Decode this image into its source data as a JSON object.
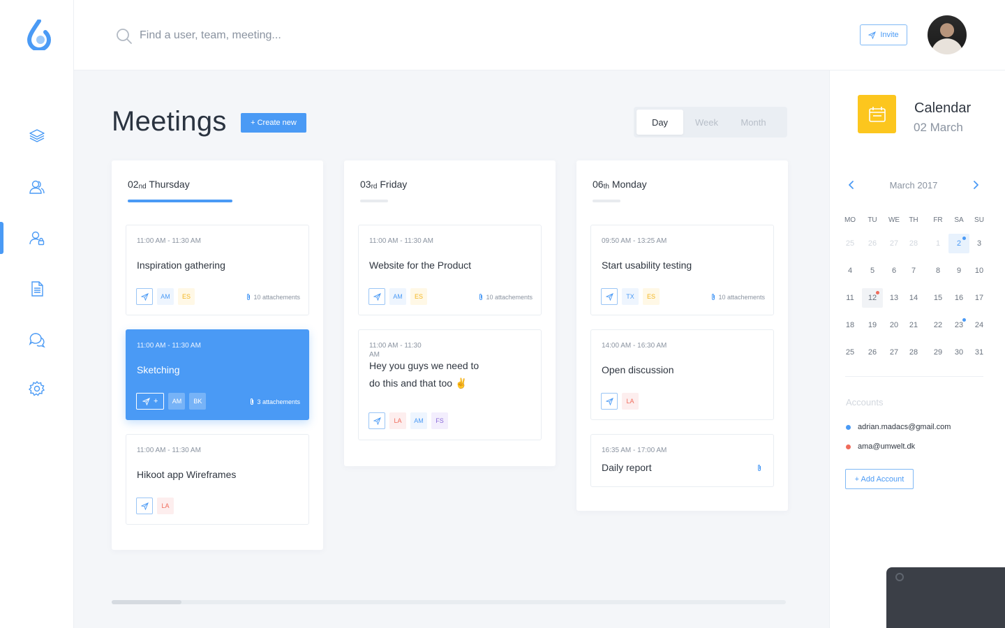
{
  "search": {
    "placeholder": "Find a user, team, meeting..."
  },
  "header": {
    "invite_label": "Invite"
  },
  "nav": {
    "items": [
      {
        "name": "layers-icon"
      },
      {
        "name": "users-icon"
      },
      {
        "name": "user-lock-icon",
        "active": true
      },
      {
        "name": "document-icon"
      },
      {
        "name": "chat-icon"
      },
      {
        "name": "gear-icon"
      }
    ]
  },
  "main": {
    "title": "Meetings",
    "create_label": "+ Create new",
    "views": [
      "Day",
      "Week",
      "Month"
    ],
    "active_view": "Day",
    "days": [
      {
        "num": "02",
        "suffix": "nd",
        "weekday": "Thursday",
        "meetings": [
          {
            "time": "11:00 AM - 11:30 AM",
            "title": "Inspiration gathering",
            "tags": [
              "AM",
              "ES"
            ],
            "attachments": "10 attachements"
          },
          {
            "time": "11:00 AM - 11:30 AM",
            "title": "Sketching",
            "tags": [
              "AM",
              "BK"
            ],
            "attachments": "3 attachements",
            "btn_plus": "+"
          },
          {
            "time": "11:00 AM - 11:30 AM",
            "title": "Hikoot app Wireframes",
            "tags": [
              "LA"
            ]
          }
        ]
      },
      {
        "num": "03",
        "suffix": "rd",
        "weekday": "Friday",
        "meetings": [
          {
            "time": "11:00 AM - 11:30 AM",
            "title": "Website for the Product",
            "tags": [
              "AM",
              "ES"
            ],
            "attachments": "10 attachements"
          },
          {
            "time_line1": "11:00 AM - 11:30",
            "time_line2": "AM",
            "title_line1": "Hey you guys we need to",
            "title_line2": "do this and that too ✌️",
            "tags": [
              "LA",
              "AM",
              "FS"
            ]
          }
        ]
      },
      {
        "num": "06",
        "suffix": "th",
        "weekday": "Monday",
        "meetings": [
          {
            "time": "09:50 AM - 13:25 AM",
            "title": "Start usability testing",
            "tags": [
              "TX",
              "ES"
            ],
            "attachments": "10 attachements"
          },
          {
            "time": "14:00 AM - 16:30 AM",
            "title": "Open discussion",
            "tags": [
              "LA"
            ]
          },
          {
            "time": "16:35 AM - 17:00 AM",
            "title": "Daily report"
          }
        ]
      }
    ]
  },
  "calendar": {
    "title": "Calendar",
    "date": "02 March",
    "month_label": "March 2017",
    "weekdays": [
      "MO",
      "TU",
      "WE",
      "TH",
      "FR",
      "SA",
      "SU"
    ],
    "weeks": [
      [
        "25",
        "26",
        "27",
        "28",
        "1",
        "2",
        "3"
      ],
      [
        "4",
        "5",
        "6",
        "7",
        "8",
        "9",
        "10"
      ],
      [
        "11",
        "12",
        "13",
        "14",
        "15",
        "16",
        "17"
      ],
      [
        "18",
        "19",
        "20",
        "21",
        "22",
        "23",
        "24"
      ],
      [
        "25",
        "26",
        "27",
        "28",
        "29",
        "30",
        "31"
      ]
    ],
    "accounts_label": "Accounts",
    "accounts": [
      {
        "email": "adrian.madacs@gmail.com",
        "color": "#4a9af5"
      },
      {
        "email": "ama@umwelt.dk",
        "color": "#ef6b5b"
      }
    ],
    "add_account_label": "+ Add Account"
  },
  "colors": {
    "accent": "#4a9af5",
    "yellow": "#fcc61e",
    "red": "#ef6b5b"
  }
}
